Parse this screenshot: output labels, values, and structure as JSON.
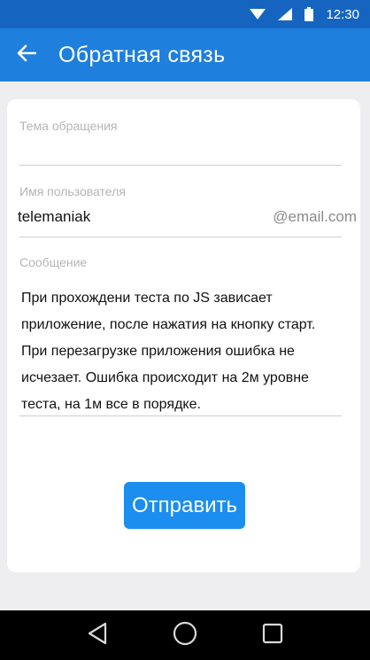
{
  "status_bar": {
    "time": "12:30",
    "icons": [
      "wifi-icon",
      "signal-icon",
      "battery-icon"
    ]
  },
  "app_bar": {
    "title": "Обратная связь",
    "back_icon": "arrow-left-icon"
  },
  "form": {
    "subject": {
      "label": "Тема обращения",
      "value": ""
    },
    "username": {
      "label": "Имя пользователя",
      "value": "telemaniak",
      "suffix": "@email.com"
    },
    "message": {
      "label": "Сообщение",
      "value": "При прохождени теста по JS зависает приложение, после нажатия на кнопку старт. При перезагрузке приложения ошибка не исчезает. Ошибка происходит на 2м уровне теста, на 1м все в порядке."
    },
    "submit_label": "Отправить"
  },
  "nav_bar": {
    "buttons": [
      "back-triangle-icon",
      "home-circle-icon",
      "recents-square-icon"
    ]
  },
  "colors": {
    "status_bar": "#1565c0",
    "app_bar": "#1e7fdc",
    "button": "#1b8ef0",
    "background": "#eeeef0"
  }
}
